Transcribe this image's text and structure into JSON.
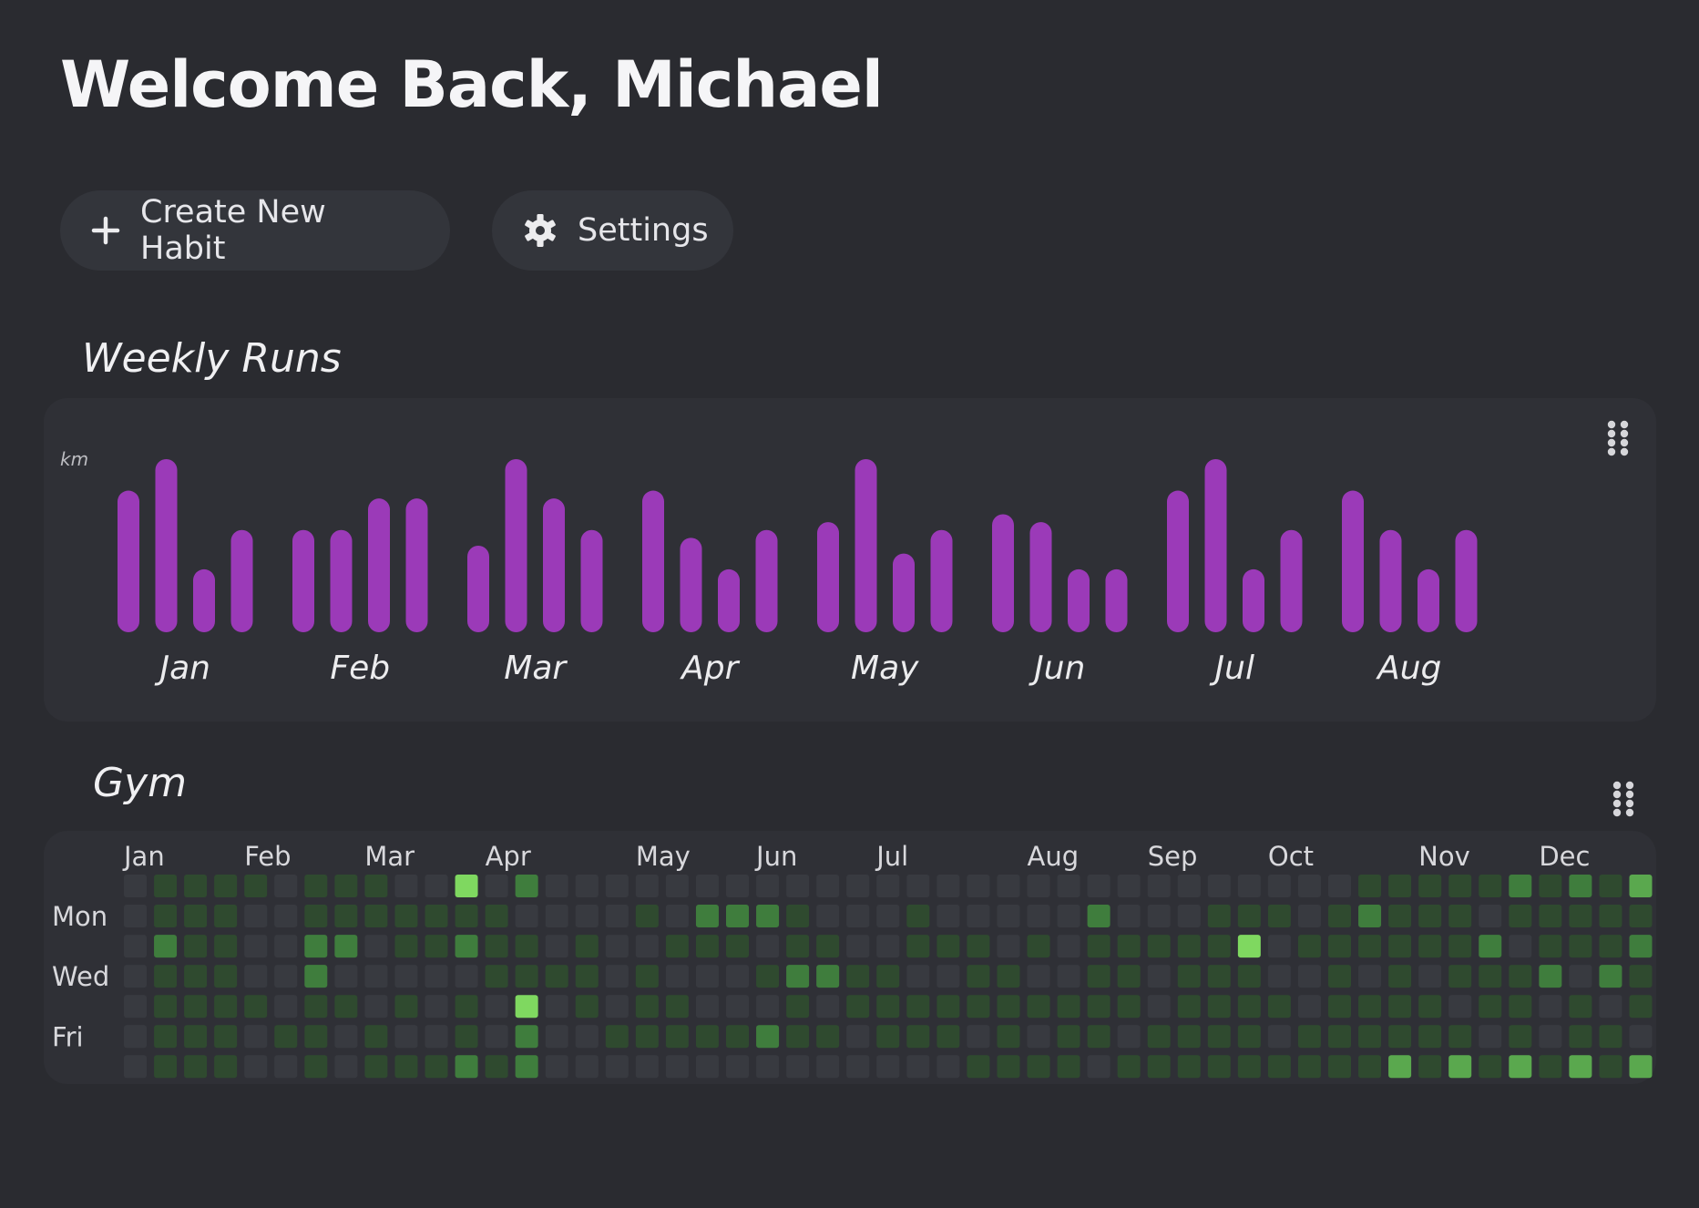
{
  "header": {
    "title": "Welcome Back, Michael"
  },
  "toolbar": {
    "create_label": "Create New Habit",
    "settings_label": "Settings",
    "create_icon": "plus-icon",
    "settings_icon": "gear-icon"
  },
  "colors": {
    "background": "#2a2b30",
    "card": "#2f3036",
    "button": "#33353b",
    "bar": "#9b3ab8",
    "heat_empty": "#383a40",
    "heat_levels": [
      "#2f4a2f",
      "#3f7d3d",
      "#5aa84e",
      "#7fd860"
    ]
  },
  "weekly_runs": {
    "title": "Weekly Runs",
    "menu_icon": "dots-grid-icon",
    "chart_data": {
      "type": "bar",
      "ylabel": "km",
      "ylim": [
        0,
        22
      ],
      "months": [
        {
          "label": "Jan",
          "values": [
            18,
            22,
            8,
            13
          ]
        },
        {
          "label": "Feb",
          "values": [
            13,
            13,
            17,
            17
          ]
        },
        {
          "label": "Mar",
          "values": [
            11,
            22,
            17,
            13
          ]
        },
        {
          "label": "Apr",
          "values": [
            18,
            12,
            8,
            13
          ]
        },
        {
          "label": "May",
          "values": [
            14,
            22,
            10,
            13
          ]
        },
        {
          "label": "Jun",
          "values": [
            15,
            14,
            8,
            8
          ]
        },
        {
          "label": "Jul",
          "values": [
            18,
            22,
            8,
            13
          ]
        },
        {
          "label": "Aug",
          "values": [
            18,
            13,
            8,
            13
          ]
        }
      ]
    }
  },
  "gym": {
    "title": "Gym",
    "menu_icon": "dots-grid-icon",
    "chart_data": {
      "type": "heatmap",
      "months": [
        {
          "label": "Jan",
          "week": 0
        },
        {
          "label": "Feb",
          "week": 4
        },
        {
          "label": "Mar",
          "week": 8
        },
        {
          "label": "Apr",
          "week": 12
        },
        {
          "label": "May",
          "week": 17
        },
        {
          "label": "Jun",
          "week": 21
        },
        {
          "label": "Jul",
          "week": 25
        },
        {
          "label": "Aug",
          "week": 30
        },
        {
          "label": "Sep",
          "week": 34
        },
        {
          "label": "Oct",
          "week": 38
        },
        {
          "label": "Nov",
          "week": 43
        },
        {
          "label": "Dec",
          "week": 47
        }
      ],
      "day_labels": [
        {
          "label": "Mon",
          "row": 1
        },
        {
          "label": "Wed",
          "row": 3
        },
        {
          "label": "Fri",
          "row": 5
        }
      ],
      "levels": [
        "0111101110040200000000000000000000000000011111212131140100000",
        "0111001111111000010222100010000020001110121110111110010000000",
        "0211002201121101001110110011101011111401111112011120110121000",
        "0111002000001111010001221100110011011100101011120210110110000",
        "0111101101010401011000101111111111011110111101101011011011011",
        "0111011010010200111112110111010110111101111110101101111110000",
        "0111001011121200000000000000111101111111113131313131313130011"
      ]
    }
  }
}
